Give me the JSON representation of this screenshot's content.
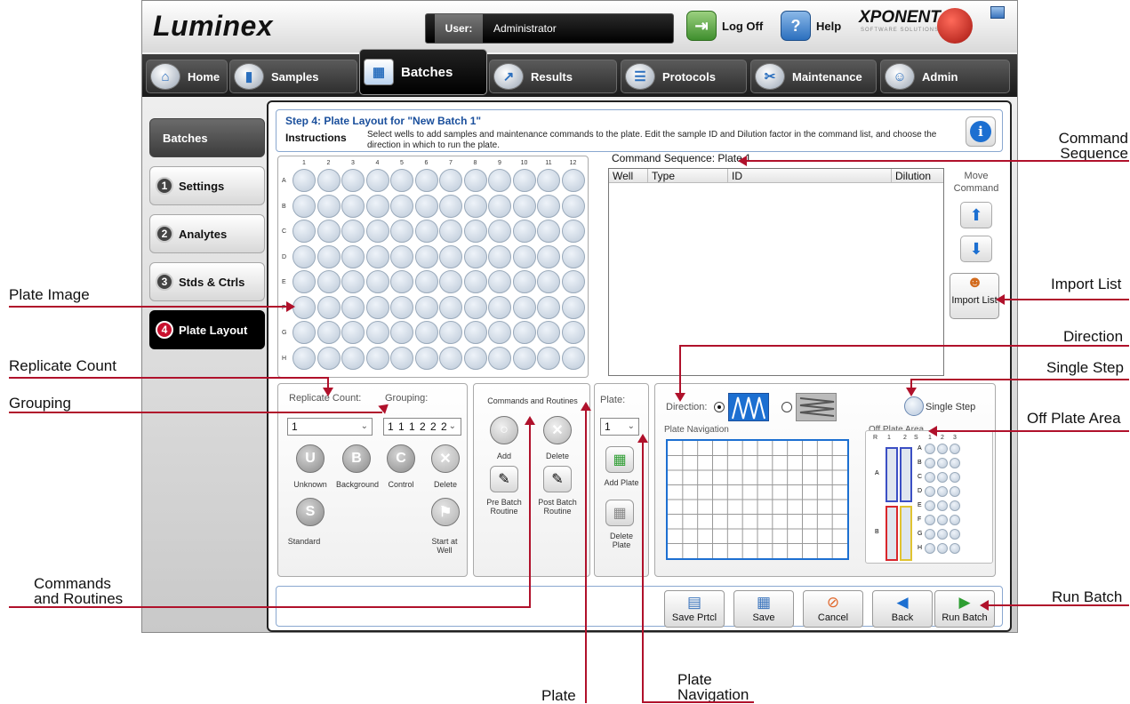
{
  "app": {
    "logo": "Luminex",
    "user_label": "User:",
    "user_value": "Administrator",
    "logoff_label": "Log Off",
    "help_label": "Help",
    "brand": "XPONENT",
    "brand_sub": "SOFTWARE SOLUTIONS"
  },
  "nav": {
    "tabs": [
      {
        "label": "Home",
        "icon": "home-icon"
      },
      {
        "label": "Samples",
        "icon": "samples-icon"
      },
      {
        "label": "Batches",
        "icon": "batches-icon",
        "active": true
      },
      {
        "label": "Results",
        "icon": "results-icon"
      },
      {
        "label": "Protocols",
        "icon": "protocols-icon"
      },
      {
        "label": "Maintenance",
        "icon": "maintenance-icon"
      },
      {
        "label": "Admin",
        "icon": "admin-icon"
      }
    ]
  },
  "sidebar": {
    "header": "Batches",
    "steps": [
      {
        "num": "1",
        "label": "Settings"
      },
      {
        "num": "2",
        "label": "Analytes"
      },
      {
        "num": "3",
        "label": "Stds & Ctrls"
      },
      {
        "num": "4",
        "label": "Plate Layout",
        "active": true
      }
    ]
  },
  "instructions": {
    "title": "Step 4: Plate Layout for \"New Batch 1\"",
    "label": "Instructions",
    "text": "Select wells to add samples and maintenance commands to the plate. Edit the sample ID and Dilution factor in the command list, and choose the direction in which to run the plate."
  },
  "plate": {
    "columns": [
      "1",
      "2",
      "3",
      "4",
      "5",
      "6",
      "7",
      "8",
      "9",
      "10",
      "11",
      "12"
    ],
    "rows": [
      "A",
      "B",
      "C",
      "D",
      "E",
      "F",
      "G",
      "H"
    ]
  },
  "command_sequence": {
    "title": "Command Sequence: Plate 1",
    "headers": [
      "Well",
      "Type",
      "ID",
      "Dilution"
    ],
    "move_command": "Move Command",
    "import_list": "Import List"
  },
  "replicate": {
    "count_label": "Replicate Count:",
    "count_value": "1",
    "grouping_label": "Grouping:",
    "grouping_value": "1 1 1 2 2 2",
    "buttons": [
      {
        "letter": "U",
        "label": "Unknown"
      },
      {
        "letter": "B",
        "label": "Background"
      },
      {
        "letter": "C",
        "label": "Control"
      },
      {
        "letter": "",
        "label": "Delete"
      },
      {
        "letter": "S",
        "label": "Standard"
      },
      {
        "letter": "",
        "label": "Start at Well"
      }
    ]
  },
  "commands": {
    "title": "Commands and Routines",
    "add": "Add",
    "delete": "Delete",
    "pre_batch": "Pre Batch Routine",
    "post_batch": "Post Batch Routine"
  },
  "plate_panel": {
    "label": "Plate:",
    "value": "1",
    "add_plate": "Add Plate",
    "delete_plate": "Delete Plate"
  },
  "direction": {
    "label": "Direction:",
    "single_step": "Single Step",
    "plate_navigation": "Plate Navigation",
    "off_plate_area": "Off Plate Area",
    "off_plate_cols": [
      "R",
      "1",
      "2",
      "S",
      "1",
      "2",
      "3"
    ],
    "off_plate_rows": [
      "A",
      "B",
      "C",
      "D",
      "E",
      "F",
      "G",
      "H"
    ],
    "reservoir_rows": [
      "A",
      "B"
    ]
  },
  "bottom": {
    "buttons": [
      "Save Prtcl",
      "Save",
      "Cancel",
      "Back",
      "Run Batch"
    ]
  },
  "callouts": {
    "plate_image": "Plate Image",
    "replicate_count": "Replicate Count",
    "grouping": "Grouping",
    "commands_and_routines_1": "Commands",
    "commands_and_routines_2": "and Routines",
    "command_sequence_1": "Command",
    "command_sequence_2": "Sequence",
    "import_list": "Import List",
    "direction": "Direction",
    "single_step": "Single Step",
    "off_plate_area": "Off Plate Area",
    "run_batch": "Run Batch",
    "plate": "Plate",
    "plate_navigation_1": "Plate",
    "plate_navigation_2": "Navigation"
  },
  "colors": {
    "callout": "#b0112b",
    "accent_blue": "#1c6fd1",
    "brand_red": "#c8102e"
  }
}
